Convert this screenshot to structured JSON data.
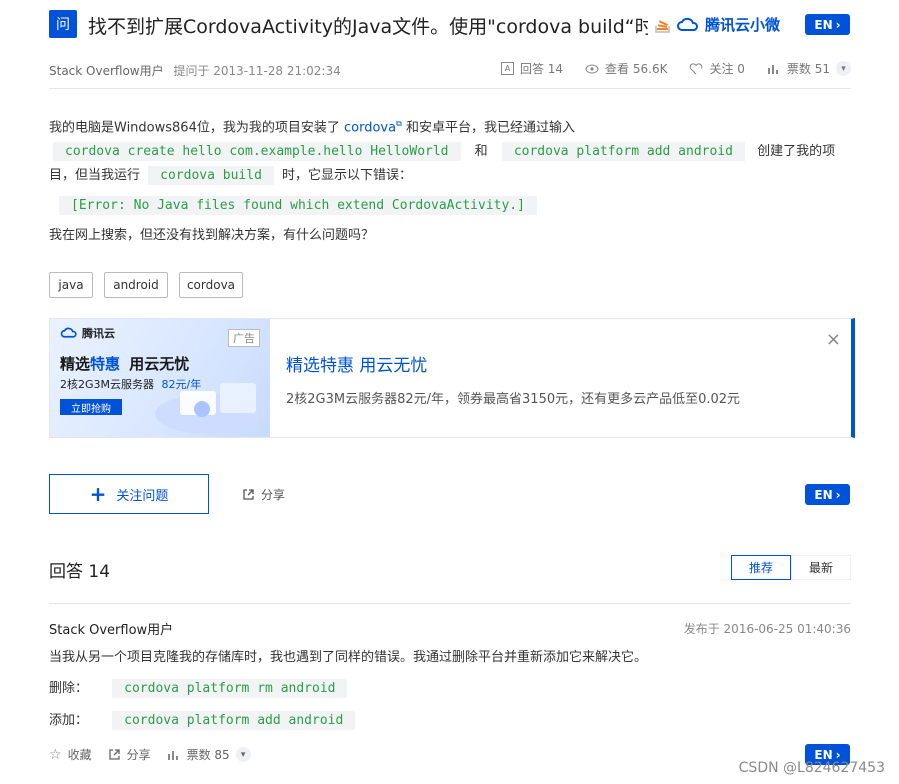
{
  "question": {
    "badge": "问",
    "title": "找不到扩展CordovaActivity的Java文件。使用\"cordova build“时",
    "brand": "腾讯云小微",
    "en_label": "EN",
    "author": "Stack Overflow用户",
    "asked": "提问于 2013-11-28 21:02:34",
    "answers_count": "回答 14",
    "views": "查看 56.6K",
    "follows": "关注 0",
    "votes": "票数 51",
    "body": {
      "line1_prefix": "我的电脑是Windows864位，我为我的项目安装了",
      "link": "cordova",
      "line1_suffix": "和安卓平台，我已经通过输入",
      "code1": "cordova create hello com.example.hello HelloWorld",
      "and": "和",
      "code2": "cordova platform add android",
      "line2_a": "创建了我的项",
      "line2_b": "目，但当我运行",
      "code3": "cordova build",
      "line2_c": "时，它显示以下错误：",
      "error": "[Error: No Java files found which extend CordovaActivity.]",
      "line3": "我在网上搜索，但还没有找到解决方案，有什么问题吗？"
    },
    "tags": [
      "java",
      "android",
      "cordova"
    ]
  },
  "ad": {
    "logo": "腾讯云",
    "tag": "广告",
    "img_title_a": "精选",
    "img_title_b": "特惠",
    "img_title_c": "用云无忧",
    "img_spec": "2核2G3M云服务器",
    "img_price": "82元/年",
    "img_cta": "立即抢购",
    "title": "精选特惠 用云无忧",
    "desc": "2核2G3M云服务器82元/年，领券最高省3150元，还有更多云产品低至0.02元"
  },
  "toolbar": {
    "follow": "关注问题",
    "share": "分享",
    "en_label": "EN"
  },
  "answers": {
    "title": "回答 14",
    "sort_recommended": "推荐",
    "sort_latest": "最新",
    "first": {
      "author": "Stack Overflow用户",
      "date": "发布于 2016-06-25 01:40:36",
      "text": "当我从另一个项目克隆我的存储库时，我也遇到了同样的错误。我通过删除平台并重新添加它来解决它。",
      "remove_label": "删除：",
      "remove_code": "cordova platform rm android",
      "add_label": "添加：",
      "add_code": "cordova platform add android",
      "collect": "收藏",
      "share": "分享",
      "votes": "票数 85",
      "en_label": "EN"
    }
  },
  "watermark": "CSDN @L824627453",
  "colors": {
    "accent": "#0052d9",
    "code_green": "#2a9e47"
  }
}
